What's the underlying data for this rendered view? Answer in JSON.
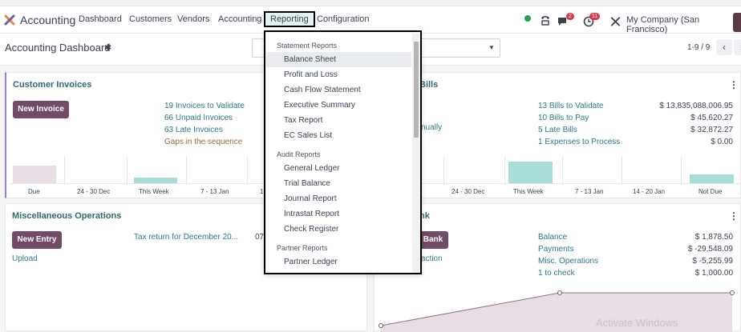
{
  "navbar": {
    "brand": "Accounting",
    "menu": [
      "Dashboard",
      "Customers",
      "Vendors",
      "Accounting",
      "Reporting",
      "Configuration"
    ],
    "active_menu": "Reporting",
    "messages_count": "2",
    "activities_count": "11",
    "company": "My Company (San Francisco)"
  },
  "control": {
    "title": "Accounting Dashboard",
    "pager": "1-9 / 9"
  },
  "customer_invoices": {
    "title": "Customer Invoices",
    "button": "New Invoice",
    "links": [
      "19 Invoices to Validate",
      "66 Unpaid Invoices",
      "63 Late Invoices",
      "Gaps in the sequence"
    ],
    "chart_labels": [
      "Due",
      "24 - 30 Dec",
      "This Week",
      "7 - 13 Jan",
      "1"
    ]
  },
  "vendor_bills": {
    "title_fragment": "Bills",
    "upload_fragment": "nually",
    "links": [
      "13 Bills to Validate",
      "10 Bills to Pay",
      "5 Late Bills",
      "1 Expenses to Process"
    ],
    "amounts": [
      "$ 13,835,088,006.95",
      "$ 45,620.27",
      "$ 32,872.27",
      "$ 0.00"
    ],
    "chart_labels": [
      "24 - 30 Dec",
      "This Week",
      "7 - 13 Jan",
      "14 - 20 Jan",
      "Not Due"
    ]
  },
  "misc_operations": {
    "title": "Miscellaneous Operations",
    "button": "New Entry",
    "upload": "Upload",
    "entry_text": "Tax return for December 20...",
    "entry_date_fragment": "07"
  },
  "bank": {
    "title_fragment": "nk",
    "button_fragment": "Bank",
    "transaction_fragment": "action",
    "rows": [
      {
        "label": "Balance",
        "amount": "$ 1,878.50"
      },
      {
        "label": "Payments",
        "amount": "$ -29,548.09"
      },
      {
        "label": "Misc. Operations",
        "amount": "$ -5,255.99"
      },
      {
        "label": "1 to check",
        "amount": "$ 1,000.00"
      }
    ]
  },
  "reporting_dropdown": {
    "sections": [
      {
        "header": "Statement Reports",
        "items": [
          "Balance Sheet",
          "Profit and Loss",
          "Cash Flow Statement",
          "Executive Summary",
          "Tax Report",
          "EC Sales List"
        ]
      },
      {
        "header": "Audit Reports",
        "items": [
          "General Ledger",
          "Trial Balance",
          "Journal Report",
          "Intrastat Report",
          "Check Register"
        ]
      },
      {
        "header": "Partner Reports",
        "items": [
          "Partner Ledger"
        ]
      }
    ],
    "hovered_item": "Balance Sheet"
  },
  "watermark": "Activate Windows",
  "colors": {
    "brand_purple": "#714b67",
    "link_teal": "#2a7a86",
    "bar_teal": "#a8dcd9",
    "bar_pink": "#e8dce5"
  }
}
